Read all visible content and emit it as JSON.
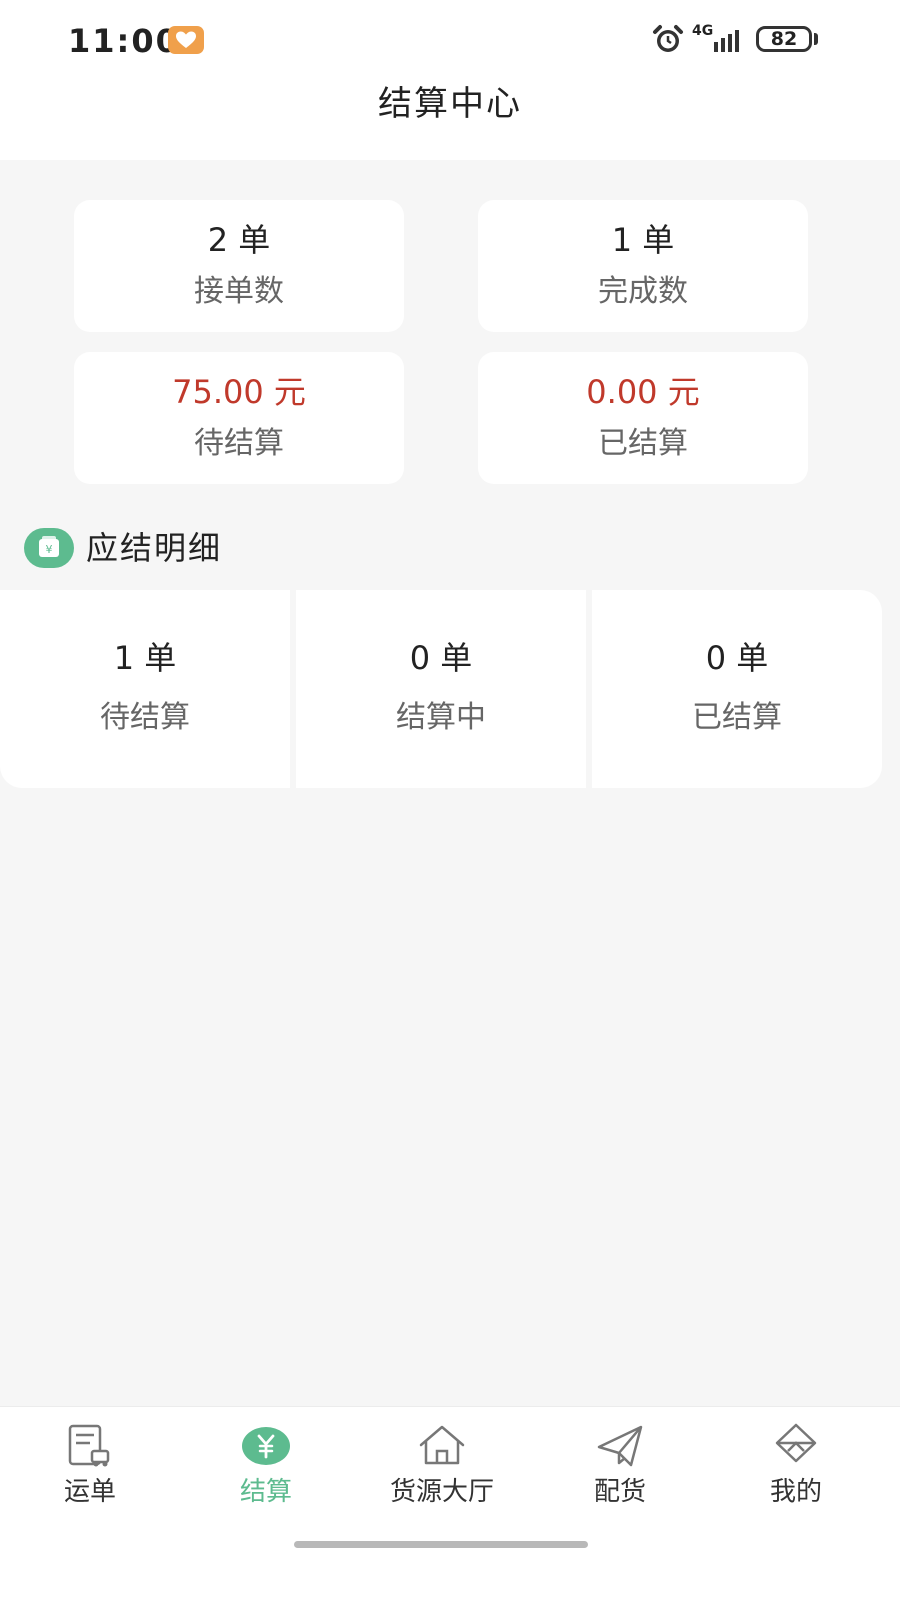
{
  "status_bar": {
    "time": "11:00",
    "network": "4G",
    "battery": "82"
  },
  "header": {
    "title": "结算中心"
  },
  "summary": {
    "orders_received": {
      "value": "2 单",
      "label": "接单数"
    },
    "orders_completed": {
      "value": "1 单",
      "label": "完成数"
    },
    "pending_amount": {
      "value": "75.00 元",
      "label": "待结算"
    },
    "settled_amount": {
      "value": "0.00 元",
      "label": "已结算"
    }
  },
  "detail_section": {
    "title": "应结明细",
    "stats": [
      {
        "value": "1 单",
        "label": "待结算"
      },
      {
        "value": "0 单",
        "label": "结算中"
      },
      {
        "value": "0 单",
        "label": "已结算"
      }
    ]
  },
  "bottom_nav": {
    "items": [
      {
        "label": "运单",
        "icon": "waybill-icon",
        "active": false
      },
      {
        "label": "结算",
        "icon": "yuan-icon",
        "active": true
      },
      {
        "label": "货源大厅",
        "icon": "house-icon",
        "active": false
      },
      {
        "label": "配货",
        "icon": "paper-plane-icon",
        "active": false
      },
      {
        "label": "我的",
        "icon": "profile-icon",
        "active": false
      }
    ]
  },
  "colors": {
    "accent": "#5dbb8f",
    "money": "#c0392b",
    "background": "#f6f6f6"
  }
}
